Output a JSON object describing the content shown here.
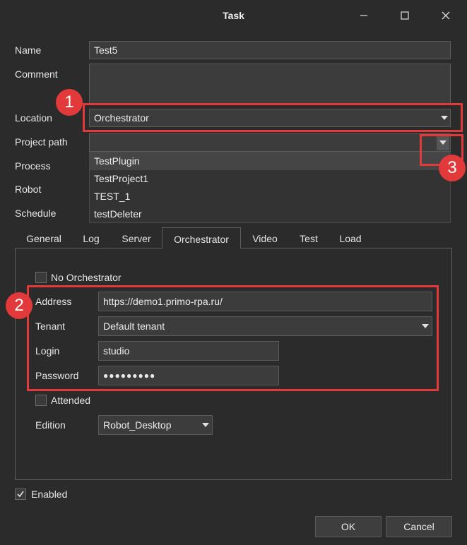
{
  "window": {
    "title": "Task",
    "minimize_icon": "minimize-icon",
    "maximize_icon": "maximize-icon",
    "close_icon": "close-icon"
  },
  "form": {
    "name_label": "Name",
    "name_value": "Test5",
    "comment_label": "Comment",
    "comment_value": "",
    "location_label": "Location",
    "location_value": "Orchestrator",
    "project_path_label": "Project path",
    "project_path_value": "",
    "process_label": "Process",
    "robot_label": "Robot",
    "schedule_label": "Schedule"
  },
  "project_dropdown": {
    "options": [
      "TestPlugin",
      "TestProject1",
      "TEST_1",
      "testDeleter"
    ],
    "highlighted_index": 0
  },
  "tabs": [
    {
      "label": "General"
    },
    {
      "label": "Log"
    },
    {
      "label": "Server"
    },
    {
      "label": "Orchestrator",
      "active": true
    },
    {
      "label": "Video"
    },
    {
      "label": "Test"
    },
    {
      "label": "Load"
    }
  ],
  "orchestrator": {
    "no_orchestrator_label": "No Orchestrator",
    "no_orchestrator_checked": false,
    "address_label": "Address",
    "address_value": "https://demo1.primo-rpa.ru/",
    "tenant_label": "Tenant",
    "tenant_value": "Default tenant",
    "login_label": "Login",
    "login_value": "studio",
    "password_label": "Password",
    "password_value": "●●●●●●●●●",
    "attended_label": "Attended",
    "attended_checked": false,
    "edition_label": "Edition",
    "edition_value": "Robot_Desktop"
  },
  "enabled": {
    "label": "Enabled",
    "checked": true
  },
  "buttons": {
    "ok": "OK",
    "cancel": "Cancel"
  },
  "annotations": {
    "badge1": "1",
    "badge2": "2",
    "badge3": "3"
  },
  "colors": {
    "accent_red": "#e23a3a",
    "background": "#2b2b2b",
    "field": "#3c3c3c"
  }
}
